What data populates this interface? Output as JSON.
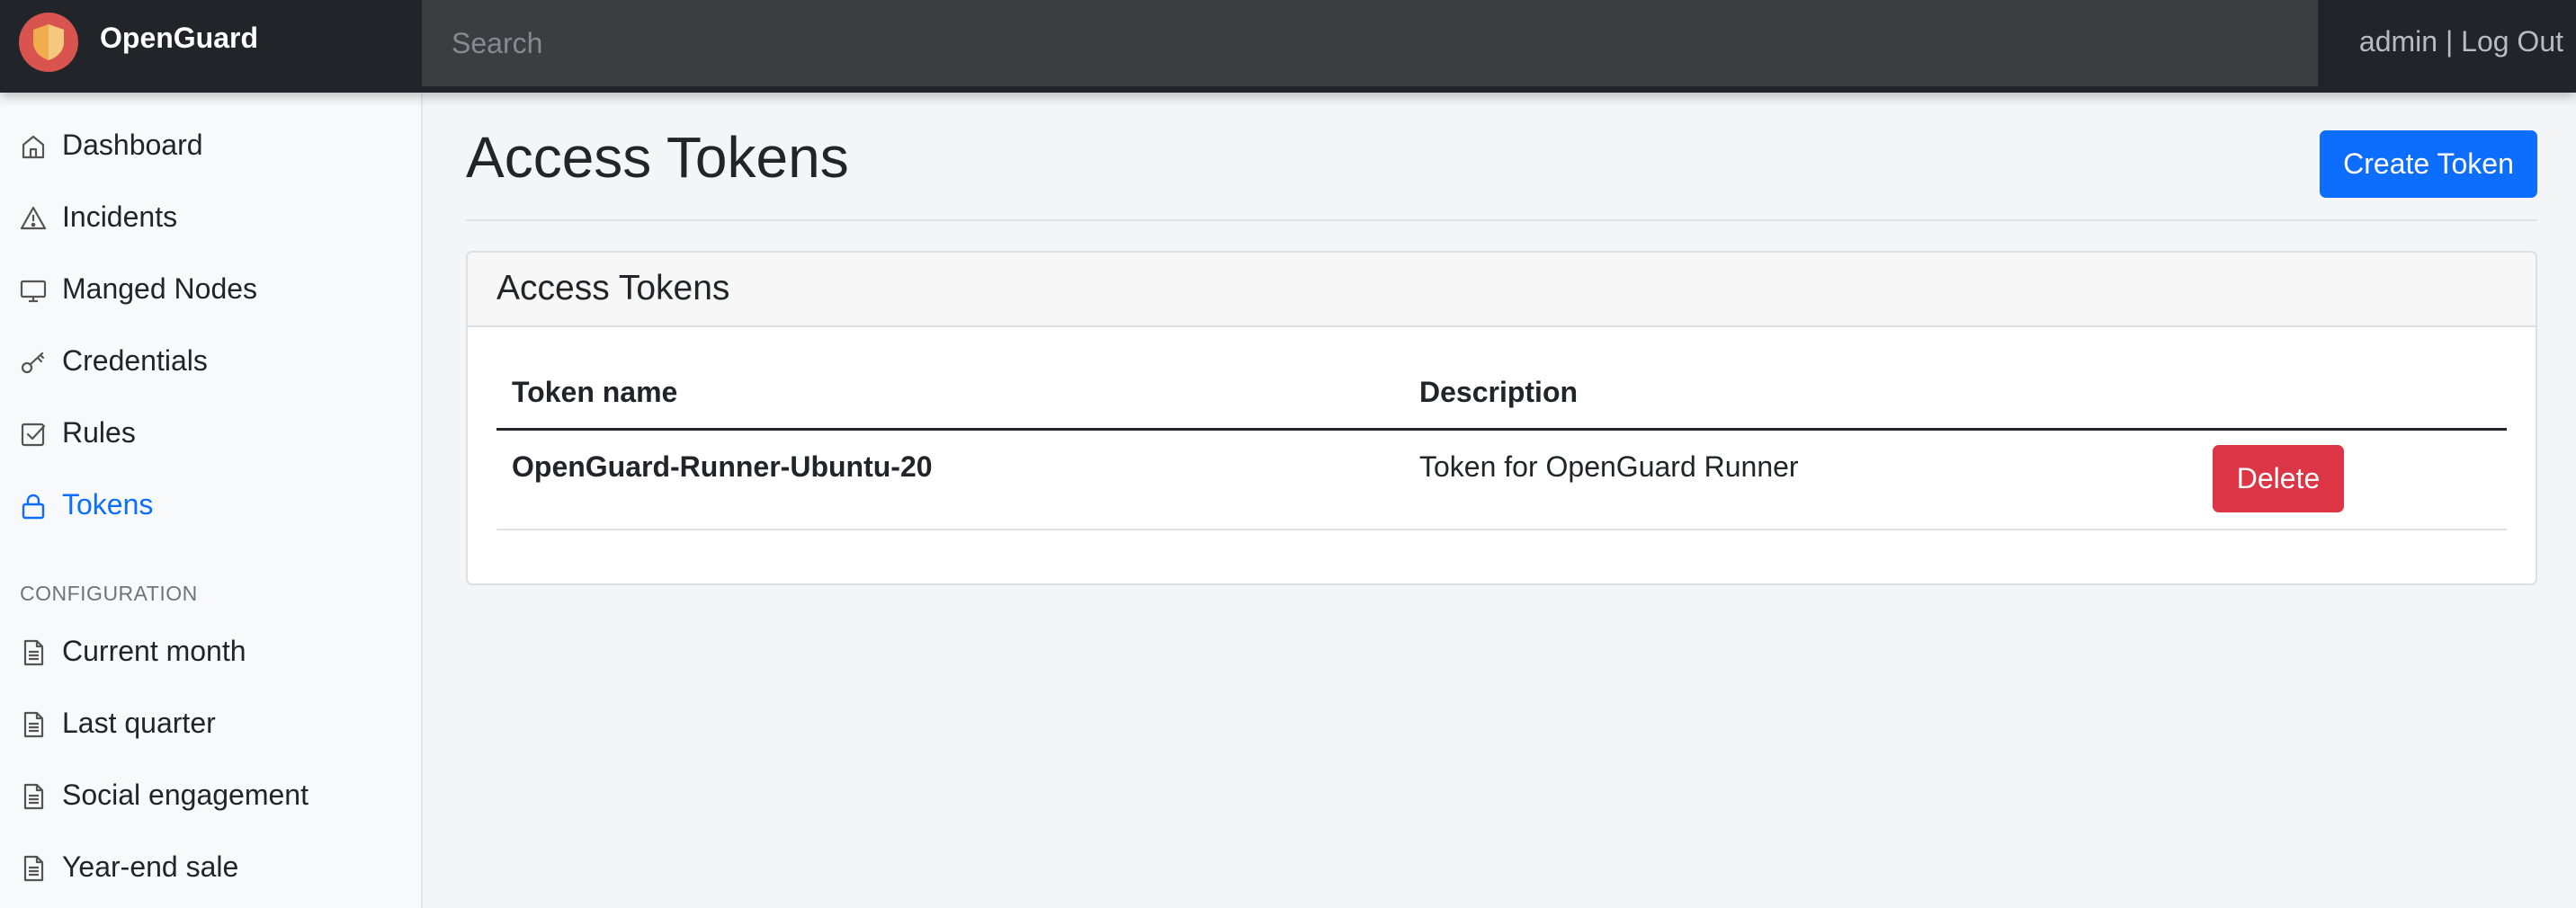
{
  "navbar": {
    "brand": "OpenGuard",
    "search_placeholder": "Search",
    "user": "admin",
    "separator": " | ",
    "logout": "Log Out"
  },
  "sidebar": {
    "items": [
      {
        "label": "Dashboard",
        "icon": "home-icon"
      },
      {
        "label": "Incidents",
        "icon": "warning-icon"
      },
      {
        "label": "Manged Nodes",
        "icon": "monitor-icon"
      },
      {
        "label": "Credentials",
        "icon": "key-icon"
      },
      {
        "label": "Rules",
        "icon": "checkbox-icon"
      },
      {
        "label": "Tokens",
        "icon": "lock-icon",
        "active": true
      }
    ],
    "section_heading": "CONFIGURATION",
    "reports": [
      {
        "label": "Current month",
        "icon": "document-icon"
      },
      {
        "label": "Last quarter",
        "icon": "document-icon"
      },
      {
        "label": "Social engagement",
        "icon": "document-icon"
      },
      {
        "label": "Year-end sale",
        "icon": "document-icon"
      }
    ]
  },
  "main": {
    "title": "Access Tokens",
    "create_button": "Create Token",
    "card": {
      "title": "Access Tokens",
      "columns": [
        "Token name",
        "Description"
      ],
      "rows": [
        {
          "name": "OpenGuard-Runner-Ubuntu-20",
          "description": "Token for OpenGuard Runner",
          "action": "Delete"
        }
      ]
    }
  },
  "colors": {
    "accent": "#0d6efd",
    "danger": "#dc3545",
    "navbar": "#212529"
  }
}
